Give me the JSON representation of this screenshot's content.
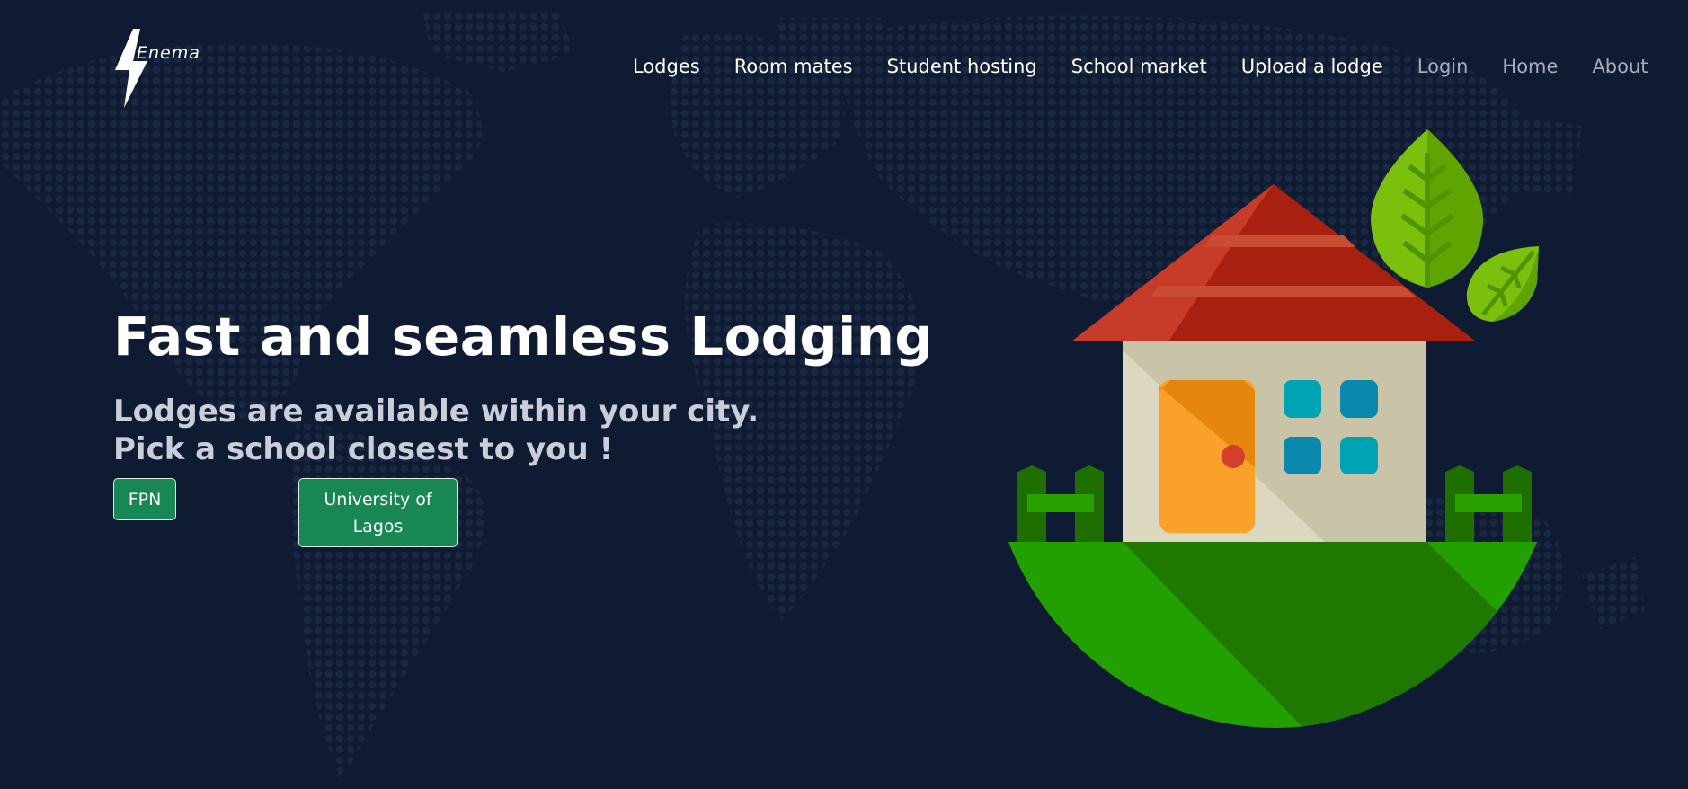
{
  "brand": {
    "name": "Enema",
    "logo_icon": "lightning-bolt-icon"
  },
  "nav": {
    "items": [
      {
        "label": "Lodges",
        "muted": false
      },
      {
        "label": "Room mates",
        "muted": false
      },
      {
        "label": "Student hosting",
        "muted": false
      },
      {
        "label": "School market",
        "muted": false
      },
      {
        "label": "Upload a lodge",
        "muted": false
      },
      {
        "label": "Login",
        "muted": true
      },
      {
        "label": "Home",
        "muted": true
      },
      {
        "label": "About",
        "muted": true
      }
    ]
  },
  "hero": {
    "title": "Fast and seamless Lodging",
    "subtitle": "Lodges are available within your city. Pick a school closest to you !",
    "schools": [
      "FPN",
      "University of Lagos"
    ]
  },
  "illustration": {
    "icon": "house-with-leaves-illustration"
  },
  "colors": {
    "background": "#0f1b33",
    "button": "#198754",
    "roof": "#a82010",
    "grass": "#22a000"
  }
}
